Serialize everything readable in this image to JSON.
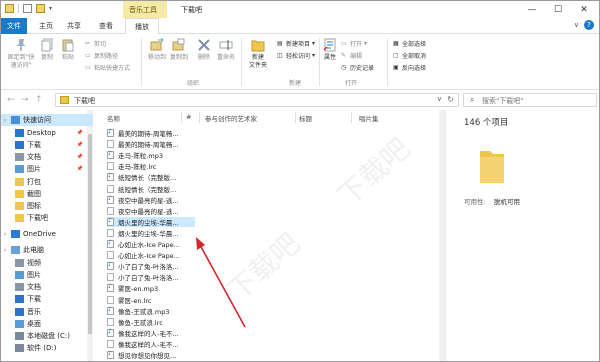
{
  "window": {
    "title": "下载吧",
    "context_tab_label": "音乐工具",
    "minimize": "—",
    "maximize": "☐",
    "close": "✕"
  },
  "tabs": {
    "file": "文件",
    "home": "主页",
    "share": "共享",
    "view": "查看",
    "play": "播放",
    "collapse": "∨",
    "help": "?"
  },
  "ribbon": {
    "pin_label_line1": "固定到\"快",
    "pin_label_line2": "速访问\"",
    "copy": "复制",
    "paste": "粘贴",
    "copy_path": "复制路径",
    "paste_shortcut": "粘贴快捷方式",
    "cut": "剪切",
    "move_to": "移动到",
    "copy_to": "复制到",
    "delete": "删除",
    "rename": "重命名",
    "new_folder_line1": "新建",
    "new_folder_line2": "文件夹",
    "new_item": "新建项目",
    "easy_access": "轻松访问",
    "properties": "属性",
    "open": "打开",
    "edit": "编辑",
    "history": "历史记录",
    "select_all": "全部选择",
    "select_none": "全部取消",
    "invert_selection": "反向选择",
    "groups": {
      "organize": "组织",
      "new": "新建",
      "open": "打开"
    }
  },
  "address": {
    "back": "←",
    "forward": "→",
    "up": "↑",
    "path": "下载吧",
    "search_placeholder": "搜索\"下载吧\""
  },
  "nav_pane": {
    "items": [
      {
        "label": "快速访问",
        "pinned": false
      },
      {
        "label": "Desktop",
        "pinned": true
      },
      {
        "label": "下载",
        "pinned": true
      },
      {
        "label": "文档",
        "pinned": true
      },
      {
        "label": "图片",
        "pinned": true
      },
      {
        "label": "打包",
        "pinned": false
      },
      {
        "label": "截图",
        "pinned": false
      },
      {
        "label": "图标",
        "pinned": false
      },
      {
        "label": "下载吧",
        "pinned": false
      },
      {
        "label": "OneDrive",
        "pinned": false
      },
      {
        "label": "此电脑",
        "pinned": false
      },
      {
        "label": "视频",
        "pinned": false
      },
      {
        "label": "图片",
        "pinned": false
      },
      {
        "label": "文档",
        "pinned": false
      },
      {
        "label": "下载",
        "pinned": false
      },
      {
        "label": "音乐",
        "pinned": false
      },
      {
        "label": "桌面",
        "pinned": false
      },
      {
        "label": "本地磁盘 (C:)",
        "pinned": false
      },
      {
        "label": "软件 (D:)",
        "pinned": false
      }
    ]
  },
  "file_list": {
    "columns": [
      "名称",
      "#",
      "参与创作的艺术家",
      "标题",
      "唱片集"
    ],
    "files": [
      {
        "name": "最美的期待-周笔畅...",
        "type": "mp3"
      },
      {
        "name": "最美的期待-周笔畅...",
        "type": "lrc"
      },
      {
        "name": "走马-陈粒.mp3",
        "type": "mp3"
      },
      {
        "name": "走马-陈粒.lrc",
        "type": "lrc"
      },
      {
        "name": "纸短情长（完整版...",
        "type": "mp3"
      },
      {
        "name": "纸短情长（完整版...",
        "type": "lrc"
      },
      {
        "name": "夜空中最亮的星-逃...",
        "type": "mp3"
      },
      {
        "name": "夜空中最亮的星-逃...",
        "type": "lrc"
      },
      {
        "name": "烟火里的尘埃-华晨...",
        "type": "mp3"
      },
      {
        "name": "烟火里的尘埃-华晨...",
        "type": "lrc"
      },
      {
        "name": "心如止水-Ice Pape...",
        "type": "mp3"
      },
      {
        "name": "心如止水-Ice Pape...",
        "type": "lrc"
      },
      {
        "name": "小了白了兔-叶洛洛...",
        "type": "mp3"
      },
      {
        "name": "小了白了兔-叶洛洛...",
        "type": "lrc"
      },
      {
        "name": "雾医-en.mp3",
        "type": "mp3"
      },
      {
        "name": "雾医-en.lrc",
        "type": "lrc"
      },
      {
        "name": "像鱼-王贰浪.mp3",
        "type": "mp3"
      },
      {
        "name": "像鱼-王贰浪.lrc",
        "type": "lrc"
      },
      {
        "name": "像我这样的人-毛不...",
        "type": "mp3"
      },
      {
        "name": "像我这样的人-毛不...",
        "type": "lrc"
      },
      {
        "name": "想见你想见你想见...",
        "type": "mp3"
      }
    ]
  },
  "details": {
    "item_count": "146 个项目",
    "availability_label": "可用性:",
    "availability_value": "脱机可用"
  },
  "colors": {
    "accent": "#1979ca",
    "selection": "#cce8ff",
    "folder": "#f0c54e",
    "arrow": "#d0282c"
  },
  "watermark": "下载吧"
}
